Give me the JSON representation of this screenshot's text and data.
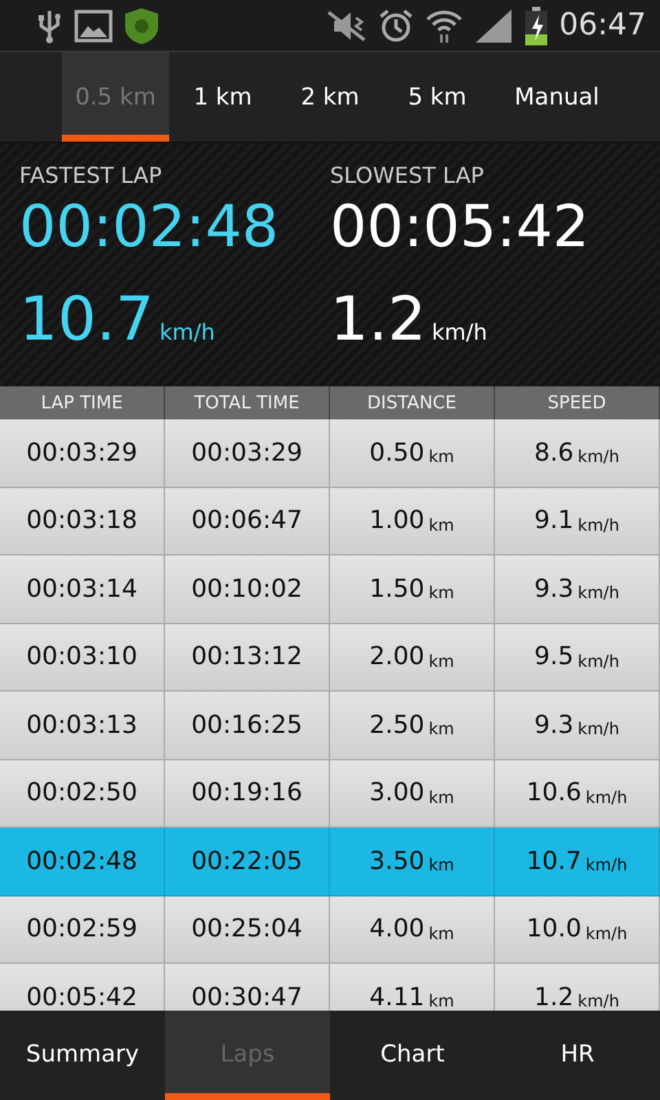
{
  "status_bar": {
    "time": "06:47"
  },
  "distance_tabs": [
    {
      "label": "0.5 km",
      "selected": true
    },
    {
      "label": "1 km",
      "selected": false
    },
    {
      "label": "2 km",
      "selected": false
    },
    {
      "label": "5 km",
      "selected": false
    },
    {
      "label": "Manual",
      "selected": false
    }
  ],
  "summary": [
    {
      "kind": "fastest",
      "title": "FASTEST LAP",
      "time": "00:02:48",
      "speed": "10.7",
      "unit": "km/h"
    },
    {
      "kind": "slowest",
      "title": "SLOWEST LAP",
      "time": "00:05:42",
      "speed": "1.2",
      "unit": "km/h"
    }
  ],
  "table": {
    "columns": [
      "LAP TIME",
      "TOTAL TIME",
      "DISTANCE",
      "SPEED"
    ],
    "rows": [
      {
        "lap_time": "00:03:29",
        "total_time": "00:03:29",
        "distance": "0.50",
        "distance_unit": "km",
        "speed": "8.6",
        "speed_unit": "km/h",
        "selected": false
      },
      {
        "lap_time": "00:03:18",
        "total_time": "00:06:47",
        "distance": "1.00",
        "distance_unit": "km",
        "speed": "9.1",
        "speed_unit": "km/h",
        "selected": false
      },
      {
        "lap_time": "00:03:14",
        "total_time": "00:10:02",
        "distance": "1.50",
        "distance_unit": "km",
        "speed": "9.3",
        "speed_unit": "km/h",
        "selected": false
      },
      {
        "lap_time": "00:03:10",
        "total_time": "00:13:12",
        "distance": "2.00",
        "distance_unit": "km",
        "speed": "9.5",
        "speed_unit": "km/h",
        "selected": false
      },
      {
        "lap_time": "00:03:13",
        "total_time": "00:16:25",
        "distance": "2.50",
        "distance_unit": "km",
        "speed": "9.3",
        "speed_unit": "km/h",
        "selected": false
      },
      {
        "lap_time": "00:02:50",
        "total_time": "00:19:16",
        "distance": "3.00",
        "distance_unit": "km",
        "speed": "10.6",
        "speed_unit": "km/h",
        "selected": false
      },
      {
        "lap_time": "00:02:48",
        "total_time": "00:22:05",
        "distance": "3.50",
        "distance_unit": "km",
        "speed": "10.7",
        "speed_unit": "km/h",
        "selected": true
      },
      {
        "lap_time": "00:02:59",
        "total_time": "00:25:04",
        "distance": "4.00",
        "distance_unit": "km",
        "speed": "10.0",
        "speed_unit": "km/h",
        "selected": false
      },
      {
        "lap_time": "00:05:42",
        "total_time": "00:30:47",
        "distance": "4.11",
        "distance_unit": "km",
        "speed": "1.2",
        "speed_unit": "km/h",
        "selected": false
      }
    ]
  },
  "bottom_tabs": [
    {
      "label": "Summary",
      "selected": false
    },
    {
      "label": "Laps",
      "selected": true
    },
    {
      "label": "Chart",
      "selected": false
    },
    {
      "label": "HR",
      "selected": false
    }
  ]
}
